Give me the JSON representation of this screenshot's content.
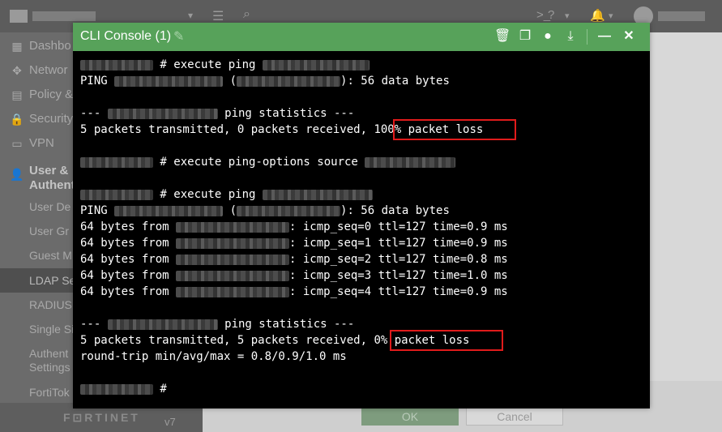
{
  "topbar": {
    "caret": "▾",
    "icons": {
      "menu": "☰",
      "search": "⌕",
      "terminal": ">_",
      "help": "?",
      "help_caret": "▾",
      "bell": "🔔",
      "bell_caret": "▾"
    }
  },
  "sidebar": {
    "items": [
      {
        "icon": "▦",
        "label": "Dashbo"
      },
      {
        "icon": "✥",
        "label": "Networ"
      },
      {
        "icon": "▤",
        "label": "Policy &"
      },
      {
        "icon": "🔒",
        "label": "Security"
      },
      {
        "icon": "▭",
        "label": "VPN"
      },
      {
        "icon": "👤",
        "label_line1": "User &",
        "label_line2": "Authent"
      },
      {
        "label": "User De"
      },
      {
        "label": "User Gr"
      },
      {
        "label": "Guest M"
      },
      {
        "label": "LDAP Se"
      },
      {
        "label": "RADIUS"
      },
      {
        "label": "Single Si"
      },
      {
        "label_line1": "Authent",
        "label_line2": "Settings"
      },
      {
        "label": "FortiTok"
      }
    ],
    "brand": "F⊡RTINET",
    "version": "v7"
  },
  "footer_buttons": {
    "ok": "OK",
    "cancel": "Cancel"
  },
  "console": {
    "title": "CLI Console (1)",
    "icons": {
      "edit": "✎",
      "clear": "🗑",
      "copy": "❐",
      "record": "●",
      "download": "⤓",
      "minimize": "—",
      "close": "✕"
    },
    "lines": {
      "l1": " # execute ping",
      "l2a": "PING ",
      "l2b": " (",
      "l2c": "): 56 data bytes",
      "l3a": "--- ",
      "l3b": " ping statistics ---",
      "l4a": "5 packets transmitted, 0 packets received, ",
      "l4b": "100% packet loss",
      "l5a": " # execute ping-options source",
      "l6": " # execute ping",
      "l7a": "PING ",
      "l7b": " (",
      "l7c": "): 56 data bytes",
      "r1a": "64 bytes from ",
      "r1b": ": icmp_seq=0 ttl=127 time=0.9 ms",
      "r2a": "64 bytes from ",
      "r2b": ": icmp_seq=1 ttl=127 time=0.9 ms",
      "r3a": "64 bytes from ",
      "r3b": ": icmp_seq=2 ttl=127 time=0.8 ms",
      "r4a": "64 bytes from ",
      "r4b": ": icmp_seq=3 ttl=127 time=1.0 ms",
      "r5a": "64 bytes from ",
      "r5b": ": icmp_seq=4 ttl=127 time=0.9 ms",
      "s1a": "--- ",
      "s1b": " ping statistics ---",
      "s2a": "5 packets transmitted, 5 packets received, ",
      "s2b": "0% packet loss",
      "s3": "round-trip min/avg/max = 0.8/0.9/1.0 ms",
      "prompt": " #"
    },
    "highlight_color": "#e01b1b"
  }
}
